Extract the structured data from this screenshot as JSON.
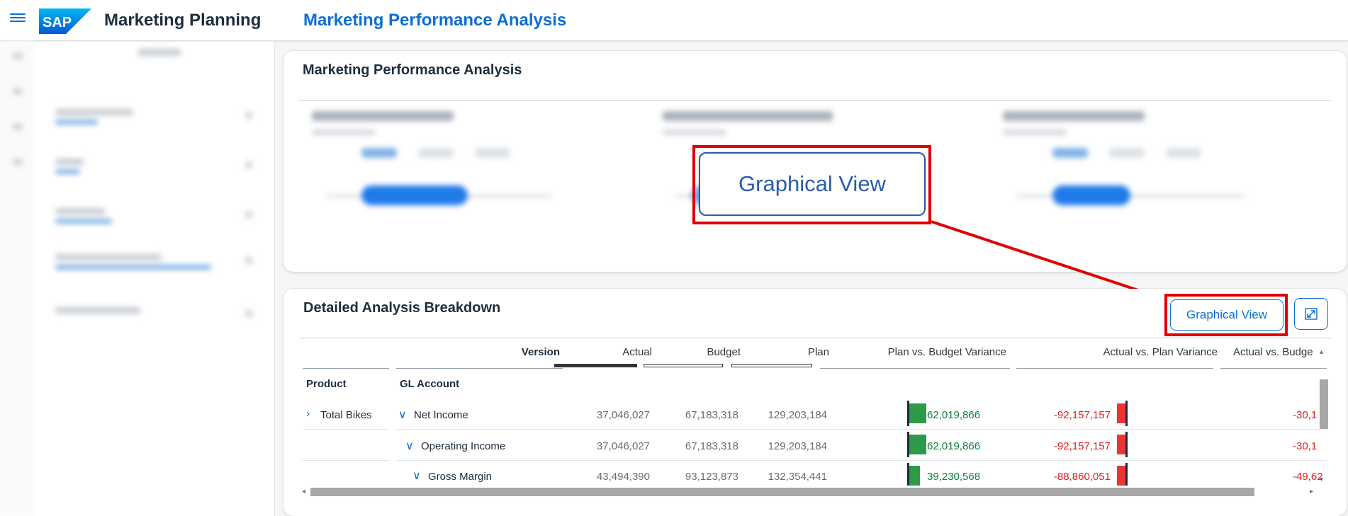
{
  "shell": {
    "logo": "SAP",
    "app_title": "Marketing Planning",
    "page_title": "Marketing Performance Analysis"
  },
  "top_card": {
    "title": "Marketing Performance Analysis"
  },
  "callout": {
    "label": "Graphical View"
  },
  "bottom_card": {
    "title": "Detailed Analysis Breakdown",
    "graphical_view_label": "Graphical View"
  },
  "table": {
    "version_header": "Version",
    "columns": [
      "Actual",
      "Budget",
      "Plan",
      "Plan vs. Budget Variance",
      "Actual vs. Plan Variance",
      "Actual vs. Budge"
    ],
    "dim_headers": {
      "product": "Product",
      "gl_account": "GL Account"
    },
    "rows": [
      {
        "product": "Total Bikes",
        "gl": "Net Income",
        "actual": "37,046,027",
        "budget": "67,183,318",
        "plan": "129,203,184",
        "pvb": "62,019,866",
        "avp": "-92,157,157",
        "avb": "-30,1"
      },
      {
        "product": "",
        "gl": "Operating Income",
        "actual": "37,046,027",
        "budget": "67,183,318",
        "plan": "129,203,184",
        "pvb": "62,019,866",
        "avp": "-92,157,157",
        "avb": "-30,1"
      },
      {
        "product": "",
        "gl": "Gross Margin",
        "actual": "43,494,390",
        "budget": "93,123,873",
        "plan": "132,354,441",
        "pvb": "39,230,568",
        "avp": "-88,860,051",
        "avb": "-49,62"
      }
    ],
    "pvb_fill": [
      1.0,
      1.0,
      0.63
    ]
  },
  "colors": {
    "brand_blue": "#0a6ed1",
    "positive": "#107e3e",
    "negative": "#e11d1d",
    "highlight_red": "#e00000"
  },
  "icons": [
    "menu-icon",
    "fullscreen-icon",
    "chevron-right-icon",
    "chevron-down-icon"
  ]
}
